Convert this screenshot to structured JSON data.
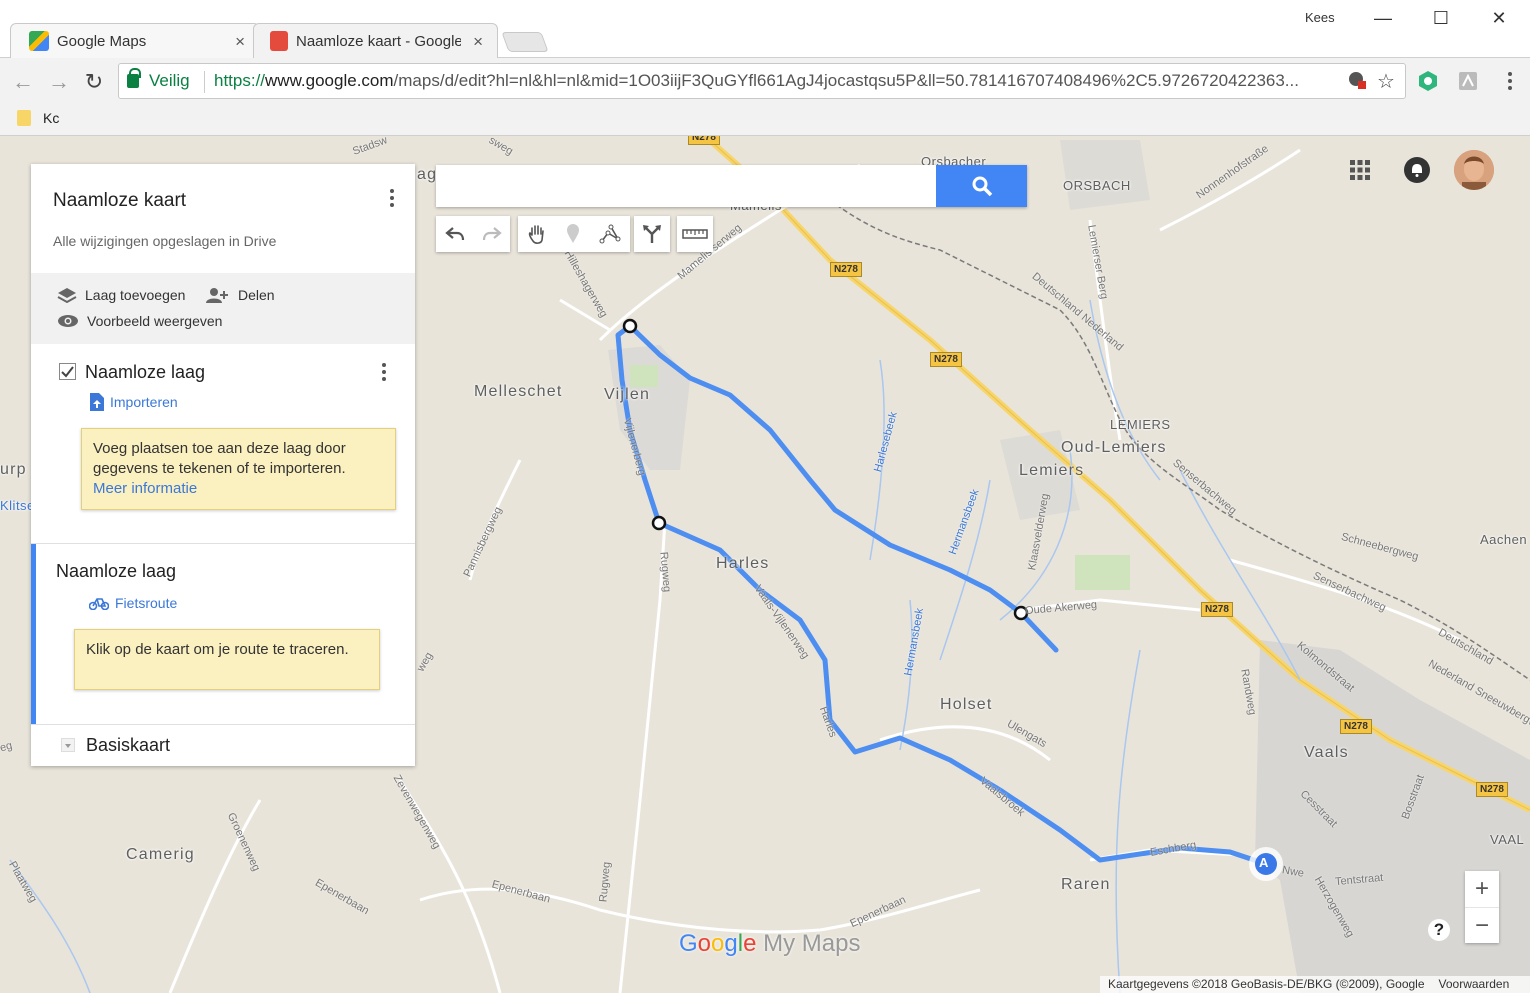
{
  "browser": {
    "tabs": [
      {
        "title": "Google Maps",
        "close": "×"
      },
      {
        "title": "Naamloze kaart - Google",
        "close": "×"
      }
    ],
    "profile_name": "Kees",
    "window_controls": [
      "—",
      "☐",
      "✕"
    ],
    "secure_label": "Veilig",
    "url_scheme": "https://",
    "url_host": "www.google.com",
    "url_path": "/maps/d/edit?hl=nl&hl=nl&mid=1O03iijF3QuGYfl661AgJ4jocastqsu5P&ll=50.781416707408496%2C5.9726720422363...",
    "bookmark": "Kc"
  },
  "panel": {
    "title": "Naamloze kaart",
    "status": "Alle wijzigingen opgeslagen in Drive",
    "add_layer": "Laag toevoegen",
    "share": "Delen",
    "preview": "Voorbeeld weergeven",
    "layer1": {
      "title": "Naamloze laag",
      "import": "Importeren",
      "tip": "Voeg plaatsen toe aan deze laag door gegevens te tekenen of te importeren.",
      "more": "Meer informatie"
    },
    "layer2": {
      "title": "Naamloze laag",
      "route_mode": "Fietsroute",
      "tip": "Klik op de kaart om je route te traceren."
    },
    "basemap": "Basiskaart"
  },
  "map": {
    "places": {
      "melleschet": "Melleschet",
      "vijlen": "Vijlen",
      "harles": "Harles",
      "holset": "Holset",
      "camerig": "Camerig",
      "raren": "Raren",
      "vaals": "Vaals",
      "lemiers": "Lemiers",
      "oud_lemiers": "Oud-Lemiers",
      "lemiers_de": "LEMIERS",
      "orsbach": "ORSBACH",
      "aachen": "Aachen",
      "vaal": "VAAL",
      "mamelis": "Mamelis",
      "orsbacher": "Orsbacher",
      "ag": "ag",
      "urp": "urp",
      "klitse": "Klitse"
    },
    "roads": {
      "hilleshagerweg": "Hilleshagerweg",
      "mamelis_serweg": "Mamelis serweg",
      "pannisbergweg": "Pannisbergweg",
      "rugweg1": "Rugweg",
      "rugweg2": "Rugweg",
      "zevenwegenweg": "Zevenwegenweg",
      "groenenweg": "Groenenweg",
      "epenerbaan1": "Epenerbaan",
      "epenerbaan2": "Epenerbaan",
      "epenerbaan3": "Epenerbaan",
      "ulengats": "Ulengats",
      "oude_akerweg": "Oude Akerweg",
      "klaasvelderweg": "Klaasvelderweg",
      "lemierser_berg": "Lemierser Berg",
      "nonnenhofstrasse": "Nonnenhofstraße",
      "schneebergweg": "Schneebergweg",
      "senserbachweg1": "Senserbachweg",
      "senserbachweg2": "Senserbachweg",
      "kolmondstraat": "Kolmondstraat",
      "cesstraat": "Cesstraat",
      "bosstraat": "Bosstraat",
      "tentstraat": "Tentstraat",
      "herzogenweg": "Herzogenweg",
      "vijlenerbos": "Vaals-Vijlenerweg",
      "harles_road": "Harles",
      "vaalserbos": "Vaalsbroek",
      "eschberg": "Eschberg",
      "vijlenerberg": "Vijlenerberg",
      "stadsweg": "Stadsw",
      "weg": "weg",
      "plaatweg": "Plaatweg",
      "sweg": "sweg",
      "randweg": "Randweg",
      "nederland_sneeuw": "Nederland Sneeuwbergweg",
      "duits_ned1": "Deutschland Nederland",
      "duits_ned2": "Deutschland",
      "neeg": "eg",
      "nwen": "Nwe",
      "herm1": "Hermansbeek",
      "herm2": "Hermansbeek",
      "harle_beek": "Harlesebeek"
    },
    "shields": [
      "N278",
      "N278",
      "N278",
      "N278",
      "N278",
      "N278"
    ],
    "route_marker": "A",
    "route_color": "#4d8ef0"
  },
  "search": {
    "placeholder": ""
  },
  "controls": {
    "zoom_in": "+",
    "zoom_out": "−",
    "help": "?"
  },
  "logo": {
    "g1": "G",
    "g2": "o",
    "g3": "o",
    "g4": "g",
    "g5": "l",
    "g6": "e",
    "rest": " My Maps"
  },
  "attribution": {
    "data": "Kaartgegevens ©2018 GeoBasis-DE/BKG (©2009), Google",
    "terms": "Voorwaarden"
  }
}
